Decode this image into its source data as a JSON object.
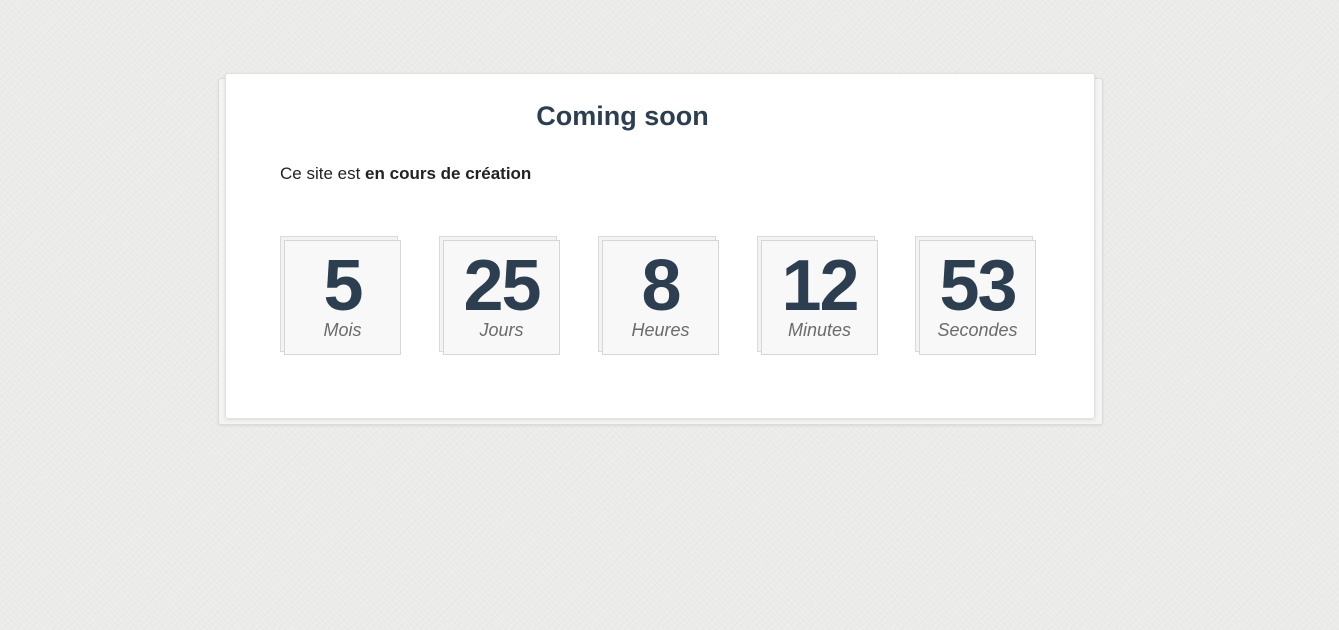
{
  "page": {
    "title": "Coming soon",
    "intro_prefix": "Ce site est ",
    "intro_bold": "en cours de création"
  },
  "countdown": {
    "units": [
      {
        "value": "5",
        "label": "Mois"
      },
      {
        "value": "25",
        "label": "Jours"
      },
      {
        "value": "8",
        "label": "Heures"
      },
      {
        "value": "12",
        "label": "Minutes"
      },
      {
        "value": "53",
        "label": "Secondes"
      }
    ]
  },
  "colors": {
    "background": "#ebebea",
    "card": "#ffffff",
    "heading": "#2c3e50",
    "label": "#6b6b6b"
  }
}
